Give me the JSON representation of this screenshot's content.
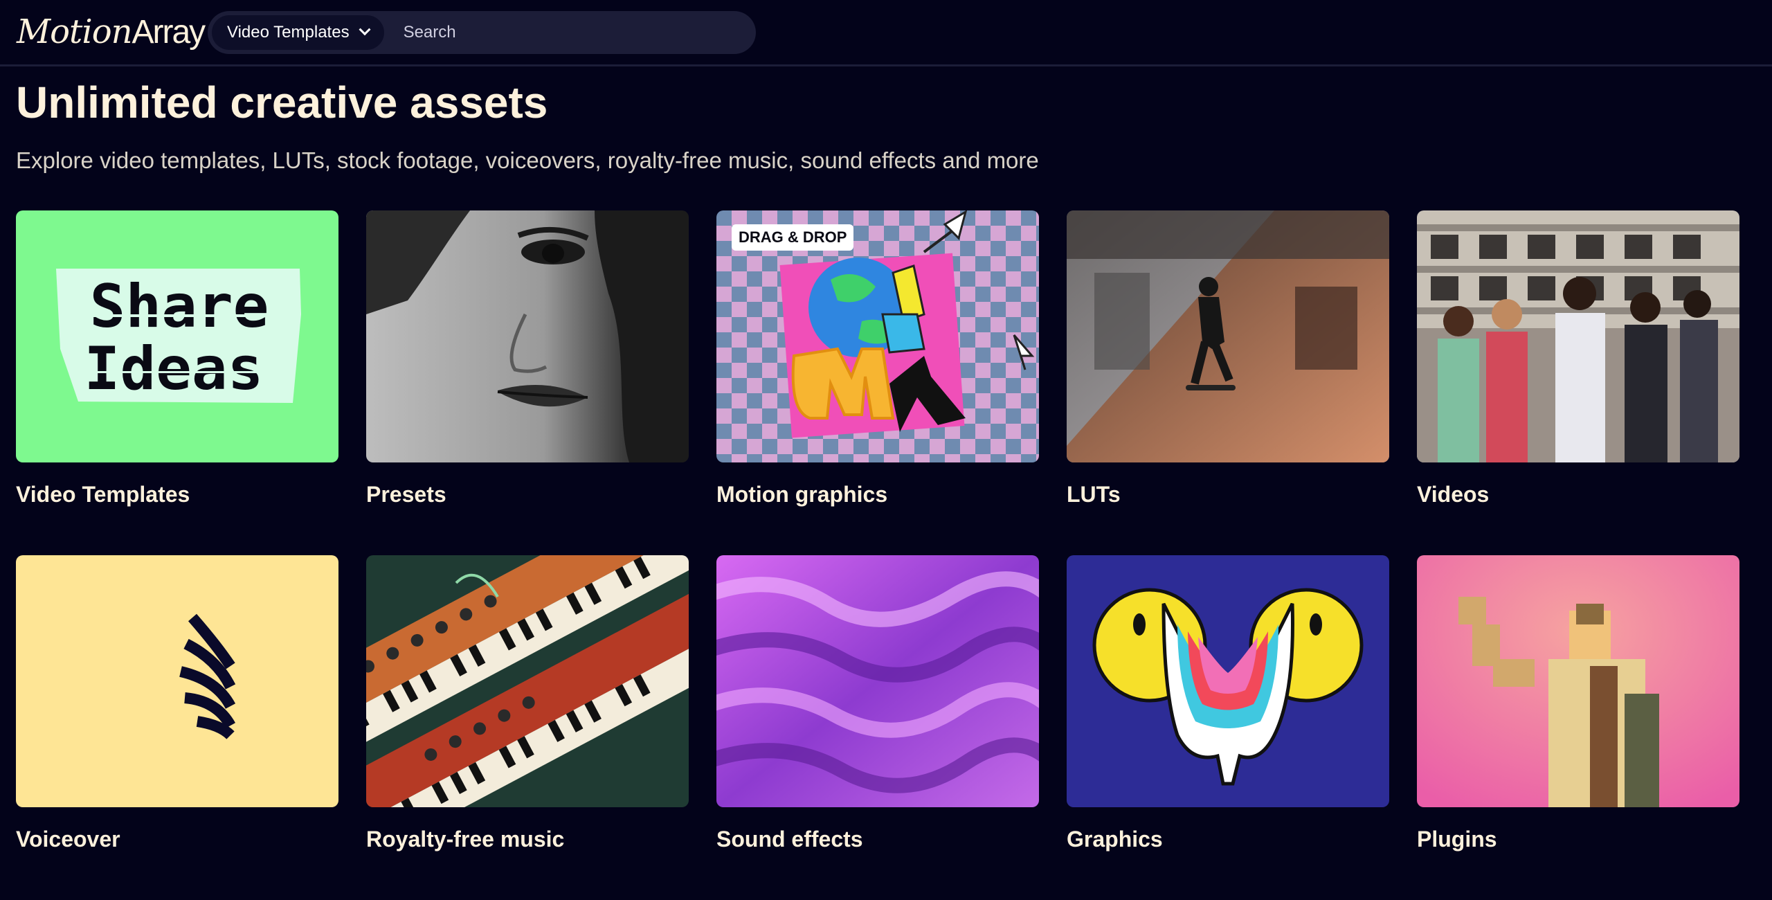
{
  "header": {
    "logo_text_1": "Motion",
    "logo_text_2": "Array",
    "category_select": "Video Templates",
    "search_placeholder": "Search"
  },
  "hero": {
    "title": "Unlimited creative assets",
    "subtitle": "Explore video templates, LUTs, stock footage, voiceovers, royalty-free music, sound effects and more"
  },
  "categories": [
    {
      "label": "Video Templates",
      "thumb_text": "Share Ideas",
      "bg": "#7ef98f"
    },
    {
      "label": "Presets",
      "bg": "#6b6b6b"
    },
    {
      "label": "Motion graphics",
      "badge": "DRAG & DROP",
      "bg": "#c7a2c9"
    },
    {
      "label": "LUTs",
      "bg": "#8a6d5c"
    },
    {
      "label": "Videos",
      "bg": "#6f6760"
    },
    {
      "label": "Voiceover",
      "bg": "#fee595"
    },
    {
      "label": "Royalty-free music",
      "bg": "#2c4a3e"
    },
    {
      "label": "Sound effects",
      "bg": "#b44ee0"
    },
    {
      "label": "Graphics",
      "bg": "#2d2c96"
    },
    {
      "label": "Plugins",
      "bg": "#ef6aa5"
    }
  ]
}
